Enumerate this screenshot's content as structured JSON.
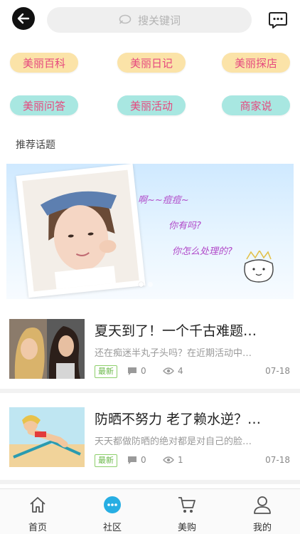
{
  "header": {
    "search_placeholder": "搜关键词"
  },
  "categories": [
    {
      "label": "美丽百科",
      "color": "#fbe3a8"
    },
    {
      "label": "美丽日记",
      "color": "#fbe3a8"
    },
    {
      "label": "美丽探店",
      "color": "#fbe3a8"
    },
    {
      "label": "美丽问答",
      "color": "#a8e7e1"
    },
    {
      "label": "美丽活动",
      "color": "#a8e7e1"
    },
    {
      "label": "商家说",
      "color": "#a8e7e1"
    }
  ],
  "section_title": "推荐话题",
  "banner": {
    "line1": "啊~~痘痘~",
    "line2": "你有吗?",
    "line3": "你怎么处理的?"
  },
  "articles": [
    {
      "title": "夏天到了！一个千古难题…",
      "summary": "还在痴迷半丸子头吗？在近期活动中…",
      "badge": "最新",
      "comments": "0",
      "views": "4",
      "date": "07-18"
    },
    {
      "title": "防晒不努力 老了赖水逆？…",
      "summary": "天天都做防晒的绝对都是对自己的脸…",
      "badge": "最新",
      "comments": "0",
      "views": "1",
      "date": "07-18"
    }
  ],
  "tabbar": {
    "items": [
      {
        "label": "首页",
        "icon": "home-icon"
      },
      {
        "label": "社区",
        "icon": "community-icon"
      },
      {
        "label": "美购",
        "icon": "cart-icon"
      },
      {
        "label": "我的",
        "icon": "profile-icon"
      }
    ],
    "active_color": "#27aee3"
  },
  "colors": {
    "pill_text": "#e6487e",
    "badge_green": "#6bb84a"
  }
}
